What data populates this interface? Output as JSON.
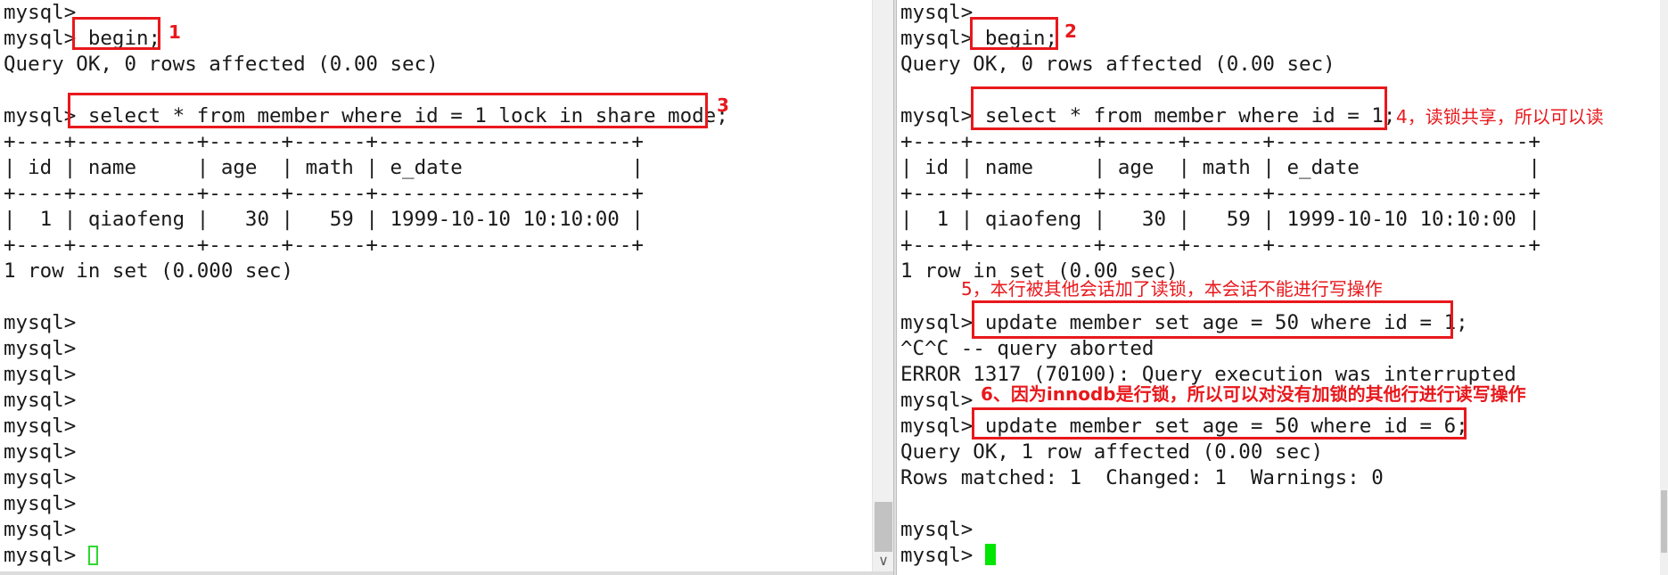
{
  "left_terminal": {
    "lines": [
      "mysql>",
      "mysql> begin;",
      "Query OK, 0 rows affected (0.00 sec)",
      "",
      "mysql> select * from member where id = 1 lock in share mode;",
      "+----+----------+------+------+---------------------+",
      "| id | name     | age  | math | e_date              |",
      "+----+----------+------+------+---------------------+",
      "|  1 | qiaofeng |   30 |   59 | 1999-10-10 10:10:00 |",
      "+----+----------+------+------+---------------------+",
      "1 row in set (0.000 sec)",
      "",
      "mysql>",
      "mysql>",
      "mysql>",
      "mysql>",
      "mysql>",
      "mysql>",
      "mysql>",
      "mysql>",
      "mysql>",
      "mysql> "
    ]
  },
  "right_terminal": {
    "lines": [
      "mysql>",
      "mysql> begin;",
      "Query OK, 0 rows affected (0.00 sec)",
      "",
      "mysql> select * from member where id = 1;",
      "+----+----------+------+------+---------------------+",
      "| id | name     | age  | math | e_date              |",
      "+----+----------+------+------+---------------------+",
      "|  1 | qiaofeng |   30 |   59 | 1999-10-10 10:10:00 |",
      "+----+----------+------+------+---------------------+",
      "1 row in set (0.00 sec)",
      "",
      "mysql> update member set age = 50 where id = 1;",
      "^C^C -- query aborted",
      "ERROR 1317 (70100): Query execution was interrupted",
      "mysql>",
      "mysql> update member set age = 50 where id = 6;",
      "Query OK, 1 row affected (0.00 sec)",
      "Rows matched: 1  Changed: 1  Warnings: 0",
      "",
      "mysql>",
      "mysql> "
    ]
  },
  "annotations": {
    "a1": "1",
    "a2": "2",
    "a3": "3",
    "a4": "4，读锁共享，所以可以读",
    "a5": "5，本行被其他会话加了读锁，本会话不能进行写操作",
    "a6": "6、因为innodb是行锁，所以可以对没有加锁的其他行进行读写操作"
  },
  "colors": {
    "annotation": "#e8181c",
    "terminal_text": "#1a1a1a",
    "left_cursor": "#2ed92e",
    "right_cursor": "#00e600"
  }
}
